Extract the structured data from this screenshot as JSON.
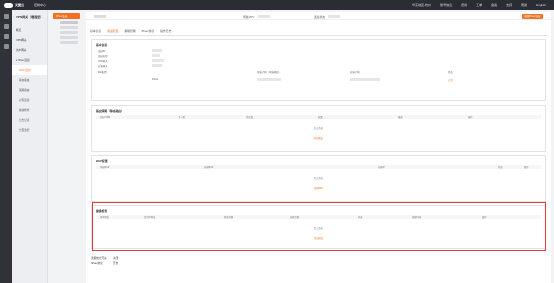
{
  "topbar": {
    "logo": "天翼云",
    "console": "控制中心",
    "nav": [
      "华东地区-杭州",
      "账号信息",
      "费用",
      "工单",
      "备案",
      "支持",
      "帮助",
      "English"
    ]
  },
  "submenu": {
    "title": "VPN网关（增强型）",
    "items": [
      {
        "label": "概览",
        "type": "group"
      },
      {
        "label": "VPN网关",
        "type": "group"
      },
      {
        "label": "用户网关",
        "type": "group"
      },
      {
        "label": "▾ IPsec连接",
        "type": "group"
      },
      {
        "label": "IPsec连接",
        "type": "active"
      },
      {
        "label": "静态路由",
        "type": "sub"
      },
      {
        "label": "策略路由",
        "type": "sub"
      },
      {
        "label": "对等连接",
        "type": "sub"
      },
      {
        "label": "健康检查",
        "type": "sub"
      },
      {
        "label": "日志记录",
        "type": "sub"
      },
      {
        "label": "告警监控",
        "type": "sub"
      }
    ]
  },
  "instances": {
    "button": "IPsec连接"
  },
  "info": {
    "k1": "所属VPC",
    "k2": "连接状态",
    "action": "编辑IPsec连接"
  },
  "tabs": [
    {
      "label": "基本信息",
      "active": false
    },
    {
      "label": "路由配置",
      "active": true
    },
    {
      "label": "策略管理",
      "active": false
    },
    {
      "label": "IPsec协议",
      "active": false
    },
    {
      "label": "操作日志",
      "active": false
    }
  ],
  "basic": {
    "title": "基本信息",
    "fields": [
      "连接ID",
      "连接名称",
      "VPN网关",
      "对端网关",
      "IKE配置"
    ],
    "col2_label": "本端子网（本端网段）",
    "col3_label": "对端子网",
    "col4_label": "状态",
    "status_text": "正常",
    "ike_value": "IKEv2"
  },
  "route_table": {
    "title": "路由策略（静态路由）",
    "headers": [
      "目标CIDR",
      "下一跳",
      "优先级",
      "权重",
      "描述",
      "操作"
    ],
    "empty": "暂无数据",
    "add": "添加路由"
  },
  "bgp": {
    "title": "BGP配置",
    "headers": [
      "本端BGP",
      "对端BGP",
      "对端IP",
      "状态",
      "操作"
    ],
    "empty": "暂无数据",
    "add": "添加BGP"
  },
  "health": {
    "title": "健康检查",
    "headers": [
      "源IP地址",
      "目的IP地址",
      "检查间隔",
      "失败次数",
      "状态",
      "创建时间",
      "操作"
    ],
    "empty": "暂无数据",
    "add": "添加检查"
  },
  "footer": {
    "label1": "流量统计开关",
    "value1": "关闭",
    "label2": "IPsec协议",
    "value2": "开启"
  }
}
